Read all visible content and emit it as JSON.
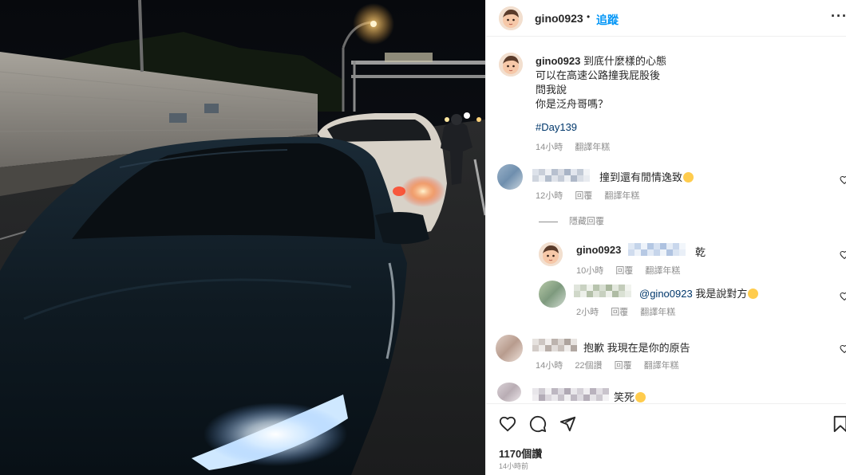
{
  "post": {
    "photo_icon": "night-highway-collision-photo"
  },
  "header": {
    "username": "gino0923",
    "separator": "•",
    "follow_label": "追蹤",
    "more_icon": "more-horizontal-icon",
    "more_label": "···"
  },
  "caption": {
    "username": "gino0923",
    "line1": "到底什麼樣的心態",
    "line2": "可以在高速公路撞我屁股後",
    "line3": "問我說",
    "line4": "你是泛舟哥嗎？",
    "hashtag": "#Day139",
    "time": "14小時",
    "translate": "翻譯年糕"
  },
  "comments": [
    {
      "text": "撞到還有閒情逸致",
      "emoji": "rolling-laughing-emoji",
      "time": "12小時",
      "reply": "回覆",
      "translate": "翻譯年糕"
    },
    {
      "hide_replies": "隱藏回覆",
      "replies": [
        {
          "username": "gino0923",
          "text": "乾",
          "time": "10小時",
          "reply": "回覆",
          "translate": "翻譯年糕"
        },
        {
          "mention": "@gino0923",
          "text": "我是說對方",
          "emoji": "sweat-smile-emoji",
          "time": "2小時",
          "reply": "回覆",
          "translate": "翻譯年糕"
        }
      ]
    },
    {
      "text": "抱歉 我現在是你的原告",
      "time": "14小時",
      "likes": "22個讚",
      "reply": "回覆",
      "translate": "翻譯年糕"
    },
    {
      "text": "笑死",
      "emoji": "laughing-tears-emoji"
    }
  ],
  "actions": {
    "like_icon": "heart-icon",
    "comment_icon": "comment-icon",
    "share_icon": "send-icon",
    "save_icon": "bookmark-icon",
    "likes": "1170個讚",
    "posted": "14小時前"
  },
  "colors": {
    "link": "#0095f6",
    "mention": "#00376b",
    "muted": "#8e8e8e"
  }
}
